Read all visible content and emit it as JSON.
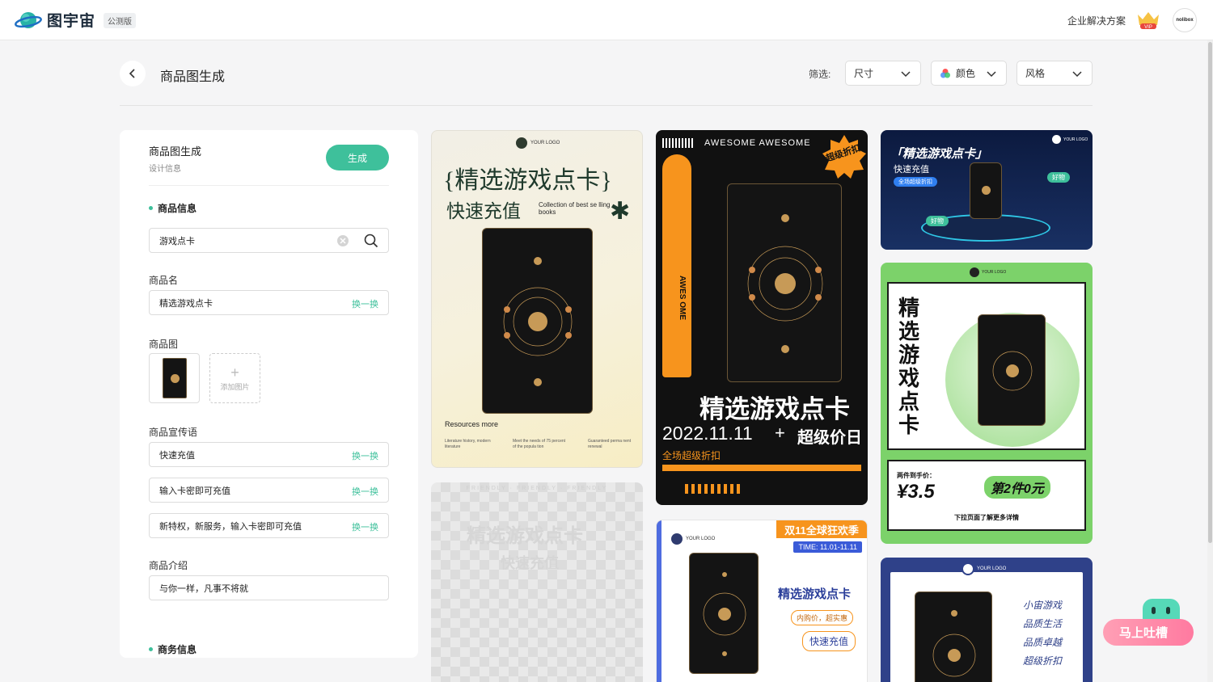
{
  "app": {
    "name": "图宇宙",
    "badge": "公测版"
  },
  "topbar": {
    "enterprise": "企业解决方案",
    "vip": "VIP",
    "avatar": "nolibox"
  },
  "page": {
    "title": "商品图生成"
  },
  "filters": {
    "label": "筛选:",
    "size": "尺寸",
    "color": "颜色",
    "style": "风格"
  },
  "panel": {
    "title": "商品图生成",
    "subtitle": "设计信息",
    "generate": "生成",
    "product_info": "商品信息",
    "search_value": "游戏点卡",
    "name_label": "商品名",
    "name_value": "精选游戏点卡",
    "swap": "换一换",
    "image_label": "商品图",
    "add_image": "添加图片",
    "slogan_label": "商品宣传语",
    "slogans": [
      "快速充值",
      "输入卡密即可充值",
      "新特权，新服务，输入卡密即可充值"
    ],
    "intro_label": "商品介绍",
    "intro_value": "与你一样，凡事不将就",
    "business_info": "商务信息"
  },
  "cards": {
    "c1": {
      "logo": "YOUR LOGO",
      "title": "{精选游戏点卡}",
      "sub": "快速充值",
      "collection": "Collection of best se lling books",
      "resources": "Resources more",
      "foot1": "Literature history, modern literature",
      "foot2": "Meet the needs of 75 percent of the popula tion",
      "foot3": "Guaranteed perma nent renewal"
    },
    "c2": {
      "title": "精选游戏点卡",
      "sub": "快速充值",
      "banner": "FRIENDLY · FRIENDLY · FRIENDLY"
    },
    "c3": {
      "header": "AWESOME AWESOME",
      "badge": "超级折扣",
      "title": "精选游戏点卡",
      "date": "2022.11.11",
      "plus": "+",
      "day": "超级价日",
      "sub": "全场超级折扣",
      "side": "AWES OME"
    },
    "c4": {
      "tag": "双11全球狂欢季",
      "time": "TIME: 11.01-11.11",
      "logo": "YOUR LOGO",
      "title": "精选游戏点卡",
      "pill1": "内购价，超实惠",
      "pill2": "快速充值"
    },
    "c5": {
      "title": "「精选游戏点卡」",
      "sub": "快速充值",
      "badge": "全场超级折扣",
      "tag1": "好物",
      "tag2": "好物",
      "logo": "YOUR LOGO"
    },
    "c6": {
      "logo": "YOUR LOGO",
      "title": "精选游戏点卡",
      "price_label": "两件到手价：",
      "price": "¥3.5",
      "promo": "第2件0元",
      "footer": "下拉页面了解更多详情"
    },
    "c7": {
      "logo": "YOUR LOGO",
      "lines": [
        "小宙游戏",
        "品质生活",
        "品质卓越",
        "超级折扣"
      ]
    }
  },
  "feedback": {
    "label": "马上吐槽"
  },
  "colors": {
    "accent": "#3ec09b",
    "orange": "#f7941d",
    "green": "#7cd26a",
    "navy": "#2f4189"
  }
}
